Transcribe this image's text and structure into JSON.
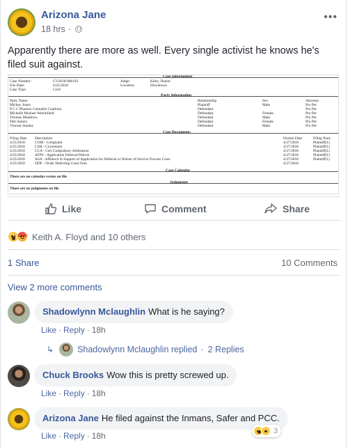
{
  "post": {
    "author": "Arizona Jane",
    "time": "18 hrs",
    "privacy_icon": "globe-icon",
    "more": "•••",
    "text": "Apparently there are more as well. Every single activist he knows he's filed suit against."
  },
  "document": {
    "section_case_info": "Case Information",
    "case_number_label": "Case Number:",
    "case_number": "CV2018-006103",
    "file_date_label": "File Date:",
    "file_date": "4/25/2018",
    "case_type_label": "Case Type:",
    "case_type": "Civil",
    "judge_label": "Judge:",
    "judge": "Kiley, Daniel",
    "location_label": "Location:",
    "location": "Downtown",
    "section_party": "Party Information",
    "party_headers": [
      "Party Name",
      "Relationship",
      "Sex",
      "Attorney"
    ],
    "parties": [
      [
        "Mickey Jones",
        "Plaintiff",
        "Male",
        "Pro Per"
      ],
      [
        "P C C Phoenix Cannabis Coalition",
        "Defendant",
        "",
        "Pro Per"
      ],
      [
        "Michelle Mushee Westinfield",
        "Defendant",
        "Female",
        "Pro Per"
      ],
      [
        "Thomas Meadows",
        "Defendant",
        "Male",
        "Pro Per"
      ],
      [
        "Deb Staiers",
        "Defendant",
        "Female",
        "Pro Per"
      ],
      [
        "Vincent Stanley",
        "Defendant",
        "Male",
        "Pro Per"
      ]
    ],
    "section_docs": "Case Documents",
    "doc_headers": [
      "Filing Date",
      "Description",
      "Docket Date",
      "Filing Party"
    ],
    "docs": [
      [
        "4/25/2018",
        "COM - Complaint",
        "4/27/2018",
        "Plaintiff(1)"
      ],
      [
        "4/25/2018",
        "CSH - Coversheet",
        "4/27/2018",
        "Plaintiff(1)"
      ],
      [
        "4/25/2018",
        "CCA - Cert Compulsory Arbitration",
        "4/27/2018",
        "Plaintiff(1)"
      ],
      [
        "4/25/2018",
        "ADW - Application Deferral/Waiver",
        "4/27/2018",
        "Plaintiff(1)"
      ],
      [
        "4/25/2018",
        "ASA - Affidavit in Support of Application for Deferral or Waiver of Service Process Costs",
        "4/27/2018",
        "Plaintiff(1)"
      ],
      [
        "4/25/2018",
        "ODF - Order Deferring Court Fees",
        "4/27/2018",
        ""
      ]
    ],
    "section_calendar": "Case Calendar",
    "no_calendar": "There are no calendar events on file",
    "section_judgments": "Judgments",
    "no_judgments": "There are no judgments on file"
  },
  "actions": {
    "like": "Like",
    "comment": "Comment",
    "share": "Share"
  },
  "reactions": {
    "names": "Keith A. Floyd and 10 others"
  },
  "stats": {
    "shares": "1 Share",
    "comments": "10 Comments"
  },
  "view_more": "View 2 more comments",
  "comments": [
    {
      "author": "Shadowlynn Mclaughlin",
      "text": "What is he saying?",
      "like": "Like",
      "reply": "Reply",
      "time": "18h"
    },
    {
      "author": "Chuck Brooks",
      "text": "Wow this is pretty screwed up.",
      "like": "Like",
      "reply": "Reply",
      "time": "18h"
    },
    {
      "author": "Arizona Jane",
      "text": "He filed against the Inmans, Safer and PCC.",
      "like": "Like",
      "reply": "Reply",
      "time": "18h",
      "reaction_count": "3"
    }
  ],
  "replies_summary": {
    "text": "Shadowlynn Mclaughlin replied",
    "count": "2 Replies"
  },
  "separator": "·"
}
